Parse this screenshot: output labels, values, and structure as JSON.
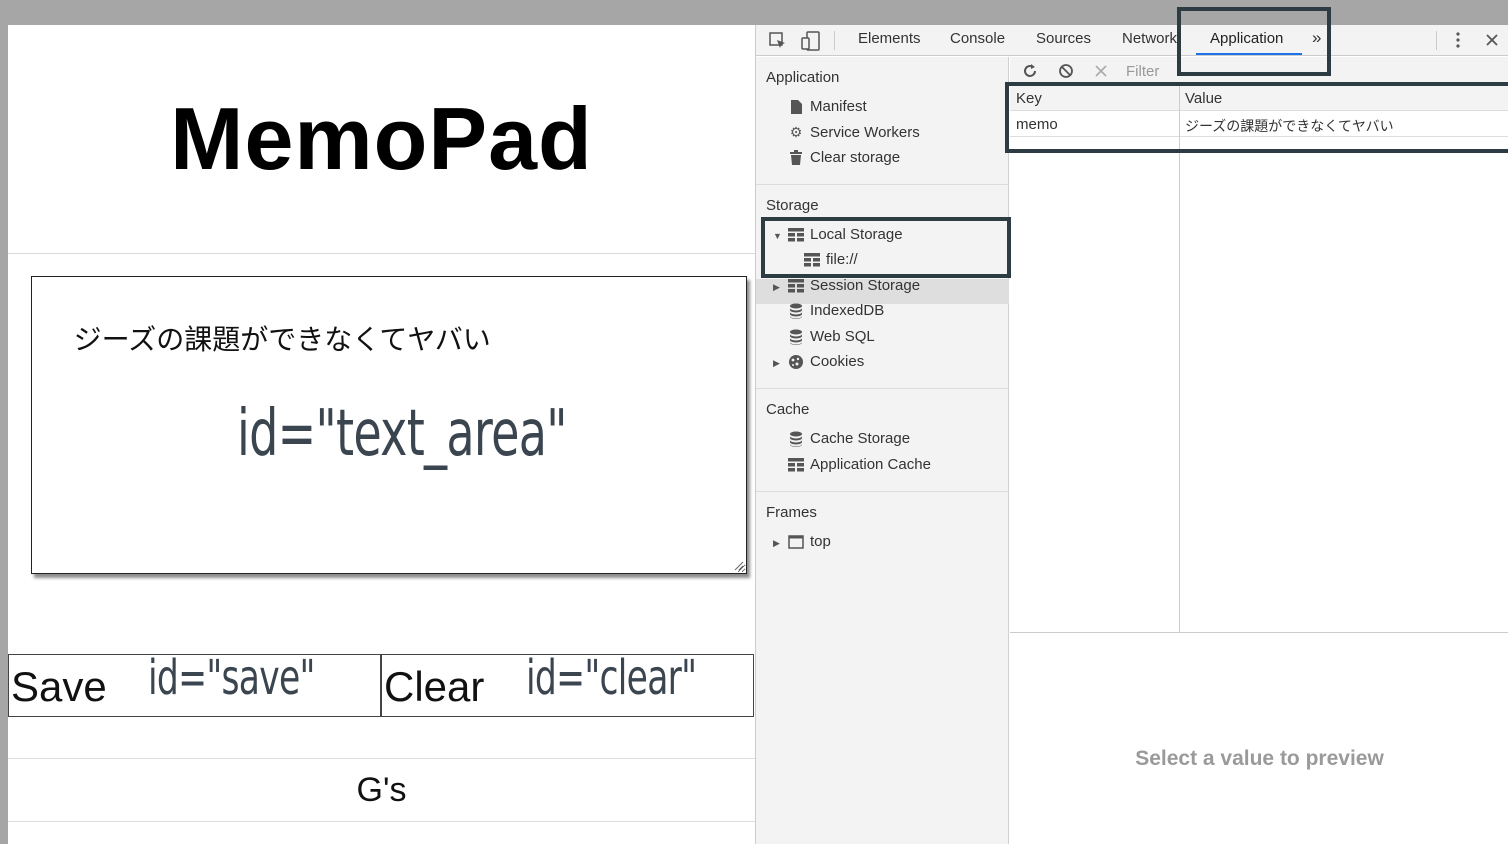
{
  "page": {
    "title": "MemoPad",
    "text_area_value": "ジーズの課題ができなくてヤバい",
    "text_area_annotation": "id=\"text_area\"",
    "save_label": "Save",
    "save_annotation": "id=\"save\"",
    "clear_label": "Clear",
    "clear_annotation": "id=\"clear\"",
    "footer": "G's"
  },
  "devtools": {
    "tabs": [
      "Elements",
      "Console",
      "Sources",
      "Network",
      "Application"
    ],
    "more_tabs": "»",
    "sidebar": {
      "application_header": "Application",
      "application_items": [
        "Manifest",
        "Service Workers",
        "Clear storage"
      ],
      "storage_header": "Storage",
      "local_storage": "Local Storage",
      "local_storage_child": "file://",
      "session_storage": "Session Storage",
      "indexeddb": "IndexedDB",
      "web_sql": "Web SQL",
      "cookies": "Cookies",
      "cache_header": "Cache",
      "cache_items": [
        "Cache Storage",
        "Application Cache"
      ],
      "frames_header": "Frames",
      "frames_top": "top"
    },
    "main": {
      "filter_placeholder": "Filter",
      "columns": [
        "Key",
        "Value"
      ],
      "rows": [
        {
          "key": "memo",
          "value": "ジーズの課題ができなくてヤバい"
        }
      ],
      "preview_text": "Select a value to preview"
    }
  }
}
